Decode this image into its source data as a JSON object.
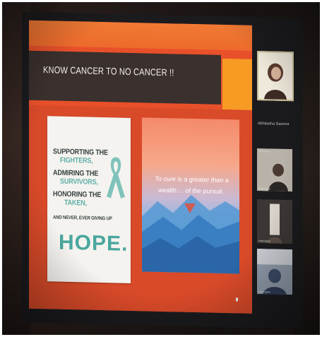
{
  "slide": {
    "title": "KNOW CANCER TO NO CANCER !!",
    "poster": {
      "lines": [
        {
          "a": "SUPPORTING THE",
          "b": ""
        },
        {
          "a": "",
          "b": "FIGHTERS,"
        },
        {
          "a": "ADMIRING THE",
          "b": ""
        },
        {
          "a": "",
          "b": "SURVIVORS,"
        },
        {
          "a": "HONORING THE",
          "b": ""
        },
        {
          "a": "",
          "b": "TAKEN,"
        },
        {
          "a": "AND NEVER, EVER GIVING UP",
          "b": ""
        }
      ],
      "hope": "HOPE."
    },
    "quote": "To cure is a greater than a wealth ... of the pursuit."
  },
  "sidebar": {
    "host_label": "",
    "section_name": "Abhilasha Saxena",
    "participants": [
      {
        "top_name": "Abhilasha",
        "label": "Participant"
      },
      {
        "top_name": "",
        "label": "Participant"
      },
      {
        "top_name": "",
        "label": "Participant"
      }
    ]
  },
  "colors": {
    "slide_orange": "#e8502a",
    "title_band": "#3a302d",
    "accent": "#f79b25",
    "teal": "#4aa79e"
  }
}
